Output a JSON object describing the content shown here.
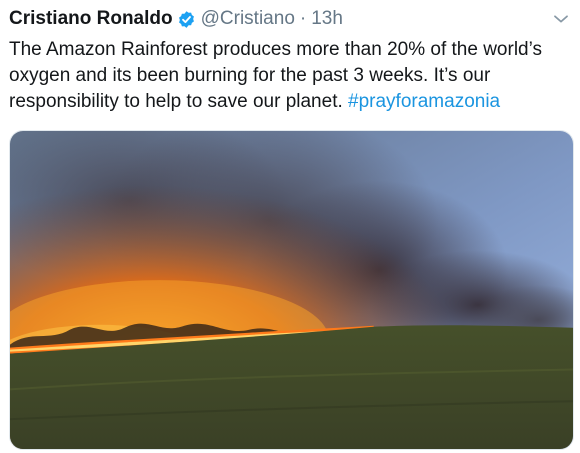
{
  "tweet": {
    "author_name": "Cristiano Ronaldo",
    "handle": "@Cristiano",
    "separator": "·",
    "time": "13h",
    "text_lines": [
      "The Amazon Rainforest produces more than 20% of the world’s",
      "oxygen and its been burning for the past 3 weeks. It’s our",
      "responsibility to help to save our planet. "
    ],
    "hashtag": "#prayforamazonia",
    "icons": {
      "verified": "verified-badge-icon",
      "menu": "chevron-down-icon"
    },
    "colors": {
      "text": "#14171a",
      "secondary": "#657786",
      "link": "#1b95e0",
      "verified": "#1da1f2"
    }
  }
}
